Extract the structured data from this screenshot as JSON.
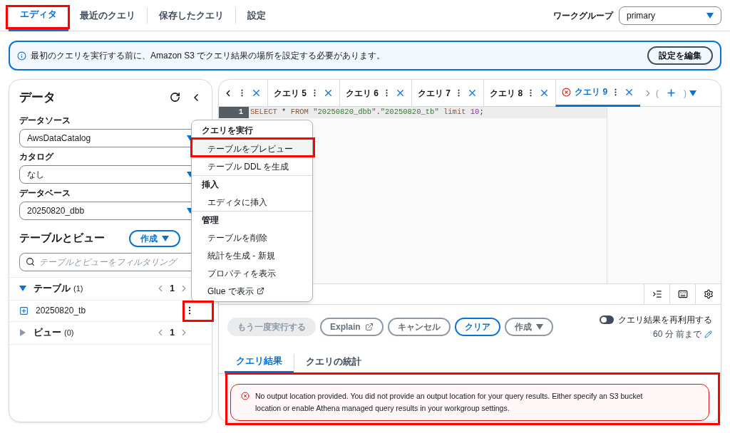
{
  "top_tabs": [
    {
      "label": "エディタ",
      "selected": true
    },
    {
      "label": "最近のクエリ",
      "selected": false
    },
    {
      "label": "保存したクエリ",
      "selected": false
    },
    {
      "label": "設定",
      "selected": false
    }
  ],
  "workgroup": {
    "label": "ワークグループ",
    "value": "primary"
  },
  "banner": {
    "text": "最初のクエリを実行する前に、Amazon S3 でクエリ結果の場所を設定する必要があります。",
    "button": "設定を編集"
  },
  "data_panel": {
    "title": "データ",
    "fields": [
      {
        "label": "データソース",
        "value": "AwsDataCatalog"
      },
      {
        "label": "カタログ",
        "value": "なし"
      },
      {
        "label": "データベース",
        "value": "20250820_dbb"
      }
    ],
    "tables_title": "テーブルとビュー",
    "create_button": "作成",
    "filter_placeholder": "テーブルとビューをフィルタリング",
    "sections": [
      {
        "label": "テーブル",
        "count": "(1)",
        "expanded": true,
        "page": "1",
        "items": [
          "20250820_tb"
        ]
      },
      {
        "label": "ビュー",
        "count": "(0)",
        "expanded": false,
        "page": "1"
      }
    ]
  },
  "query_tabs": [
    {
      "label": "クエリ 5",
      "selected": false,
      "error": false
    },
    {
      "label": "クエリ 6",
      "selected": false,
      "error": false
    },
    {
      "label": "クエリ 7",
      "selected": false,
      "error": false
    },
    {
      "label": "クエリ 8",
      "selected": false,
      "error": false
    },
    {
      "label": "クエリ 9",
      "selected": true,
      "error": true
    }
  ],
  "tab_extra": [
    "(",
    ")"
  ],
  "editor": {
    "line_number": "1",
    "tokens": [
      {
        "kind": "keyword",
        "text": "SELECT"
      },
      {
        "kind": "plain",
        "text": " * "
      },
      {
        "kind": "keyword",
        "text": "FROM "
      },
      {
        "kind": "string",
        "text": "\"20250820_dbb\""
      },
      {
        "kind": "plain",
        "text": "."
      },
      {
        "kind": "string",
        "text": "\"20250820_tb\""
      },
      {
        "kind": "keyword",
        "text": " limit "
      },
      {
        "kind": "number",
        "text": "10"
      },
      {
        "kind": "plain",
        "text": ";"
      }
    ]
  },
  "context_menu": [
    {
      "kind": "header",
      "label": "クエリを実行"
    },
    {
      "kind": "item",
      "label": "テーブルをプレビュー",
      "selected": true
    },
    {
      "kind": "item",
      "label": "テーブル DDL を生成",
      "selected": false
    },
    {
      "kind": "header",
      "label": "挿入"
    },
    {
      "kind": "item",
      "label": "エディタに挿入",
      "selected": false
    },
    {
      "kind": "header",
      "label": "管理"
    },
    {
      "kind": "item",
      "label": "テーブルを削除",
      "selected": false
    },
    {
      "kind": "item",
      "label": "統計を生成 - 新規",
      "selected": false
    },
    {
      "kind": "item",
      "label": "プロパティを表示",
      "selected": false
    },
    {
      "kind": "external",
      "label": "Glue で表示",
      "selected": false
    }
  ],
  "actions": [
    {
      "label": "もう一度実行する",
      "kind": "disabled"
    },
    {
      "label": "Explain",
      "kind": "external"
    },
    {
      "label": "キャンセル",
      "kind": "normal"
    },
    {
      "label": "クリア",
      "kind": "primary"
    },
    {
      "label": "作成",
      "kind": "dropdown"
    }
  ],
  "reuse": {
    "label": "クエリ結果を再利用する",
    "on": false,
    "note": "60 分 前まで"
  },
  "result_tabs": [
    {
      "label": "クエリ結果",
      "selected": true
    },
    {
      "label": "クエリの統計",
      "selected": false
    }
  ],
  "error": {
    "text": "No output location provided. You did not provide an output location for your query results. Either specify an S3 bucket location or enable Athena managed query results in your workgroup settings."
  }
}
